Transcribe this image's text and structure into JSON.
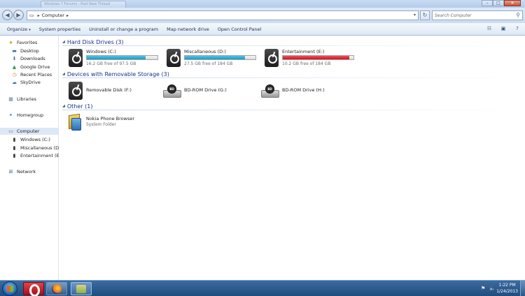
{
  "window": {
    "tab_title": "Windows 7 Forums - Post New Thread",
    "min_glyph": "–",
    "max_glyph": "□",
    "close_glyph": "✕"
  },
  "address": {
    "crumb": "Computer",
    "back_glyph": "◀",
    "forward_glyph": "▶",
    "sep_glyph": "▸",
    "dropdown_glyph": "▾",
    "refresh_glyph": "↻"
  },
  "search": {
    "placeholder": "Search Computer",
    "icon_glyph": "⚲"
  },
  "toolbar": {
    "organize": "Organize",
    "organize_arrow": "▾",
    "system_properties": "System properties",
    "uninstall": "Uninstall or change a program",
    "map_drive": "Map network drive",
    "control_panel": "Open Control Panel",
    "view_glyph": "☷",
    "pane_glyph": "▣",
    "help_glyph": "?"
  },
  "nav": {
    "favorites": "Favorites",
    "desktop": "Desktop",
    "downloads": "Downloads",
    "google_drive": "Google Drive",
    "recent_places": "Recent Places",
    "skydrive": "SkyDrive",
    "libraries": "Libraries",
    "homegroup": "Homegroup",
    "computer": "Computer",
    "drive_c": "Windows (C:)",
    "drive_d": "Miscallaneous (D:)",
    "drive_e": "Entertainment (E:)",
    "network": "Network"
  },
  "groups": {
    "hdd": "Hard Disk Drives (3)",
    "removable": "Devices with Removable Storage (3)",
    "other": "Other (1)",
    "triangle": "◢"
  },
  "hard_drives": [
    {
      "name": "Windows (C:)",
      "free": "16.2 GB free of 97.5 GB",
      "used_percent": 83,
      "bar_color": "blue"
    },
    {
      "name": "Miscallaneous (D:)",
      "free": "27.5 GB free of 184 GB",
      "used_percent": 85,
      "bar_color": "blue"
    },
    {
      "name": "Entertainment (E:)",
      "free": "10.2 GB free of 184 GB",
      "used_percent": 94,
      "bar_color": "red"
    }
  ],
  "removable": {
    "disk_f": "Removable Disk (F:)",
    "bd_g": "BD-ROM Drive (G:)",
    "bd_h": "BD-ROM Drive (H:)",
    "bd_badge": "BD"
  },
  "other": {
    "name": "Nokia Phone Browser",
    "type": "System Folder"
  },
  "taskbar": {
    "time": "1:22 PM",
    "date": "1/24/2013",
    "flag_glyph": "⚑",
    "volume_glyph": "🔈"
  },
  "colors": {
    "group_header": "#1e3287",
    "bar_blue": "#2298c7",
    "bar_red": "#d4121c",
    "taskbar": "#1f4d80"
  }
}
